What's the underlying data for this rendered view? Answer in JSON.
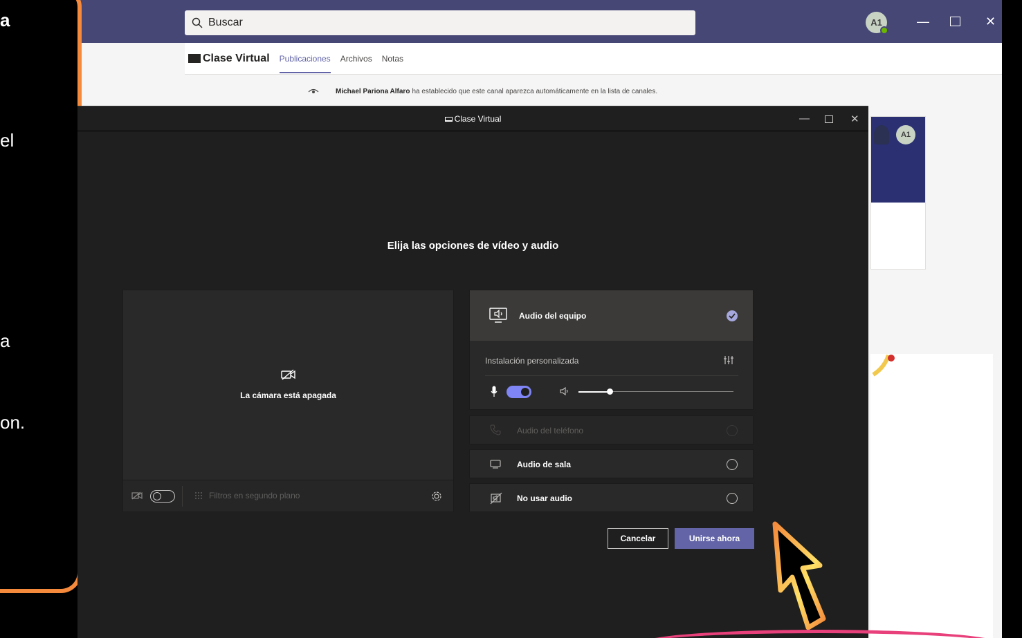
{
  "teams": {
    "search_placeholder": "Buscar",
    "avatar_initials": "A1",
    "channel_name": "Clase Virtual",
    "tabs": [
      "Publicaciones",
      "Archivos",
      "Notas"
    ],
    "notice_author": "Michael Pariona Alfaro",
    "notice_text": "ha establecido que este canal aparezca automáticamente en la lista de canales.",
    "card_avatar_initials": "A1"
  },
  "callout": {
    "fragments": [
      "a",
      "el",
      "a",
      "on."
    ]
  },
  "meeting": {
    "window_title": "Clase Virtual",
    "heading": "Elija las opciones de vídeo y audio",
    "camera_off_text": "La cámara está apagada",
    "filters_label": "Filtros en segundo plano",
    "audio_options": {
      "computer_audio": "Audio del equipo",
      "custom_setup": "Instalación personalizada",
      "phone_audio": "Audio del teléfono",
      "room_audio": "Audio de sala",
      "no_audio": "No usar audio"
    },
    "selected_audio": "Audio del equipo",
    "mic_on": true,
    "camera_on": false,
    "speaker_volume": 0.2,
    "cancel_label": "Cancelar",
    "join_label": "Unirse ahora"
  },
  "colors": {
    "teams_header": "#464775",
    "accent": "#6264a7",
    "callout_border": "#f58a3c",
    "pink_annotation": "#e8407a"
  }
}
